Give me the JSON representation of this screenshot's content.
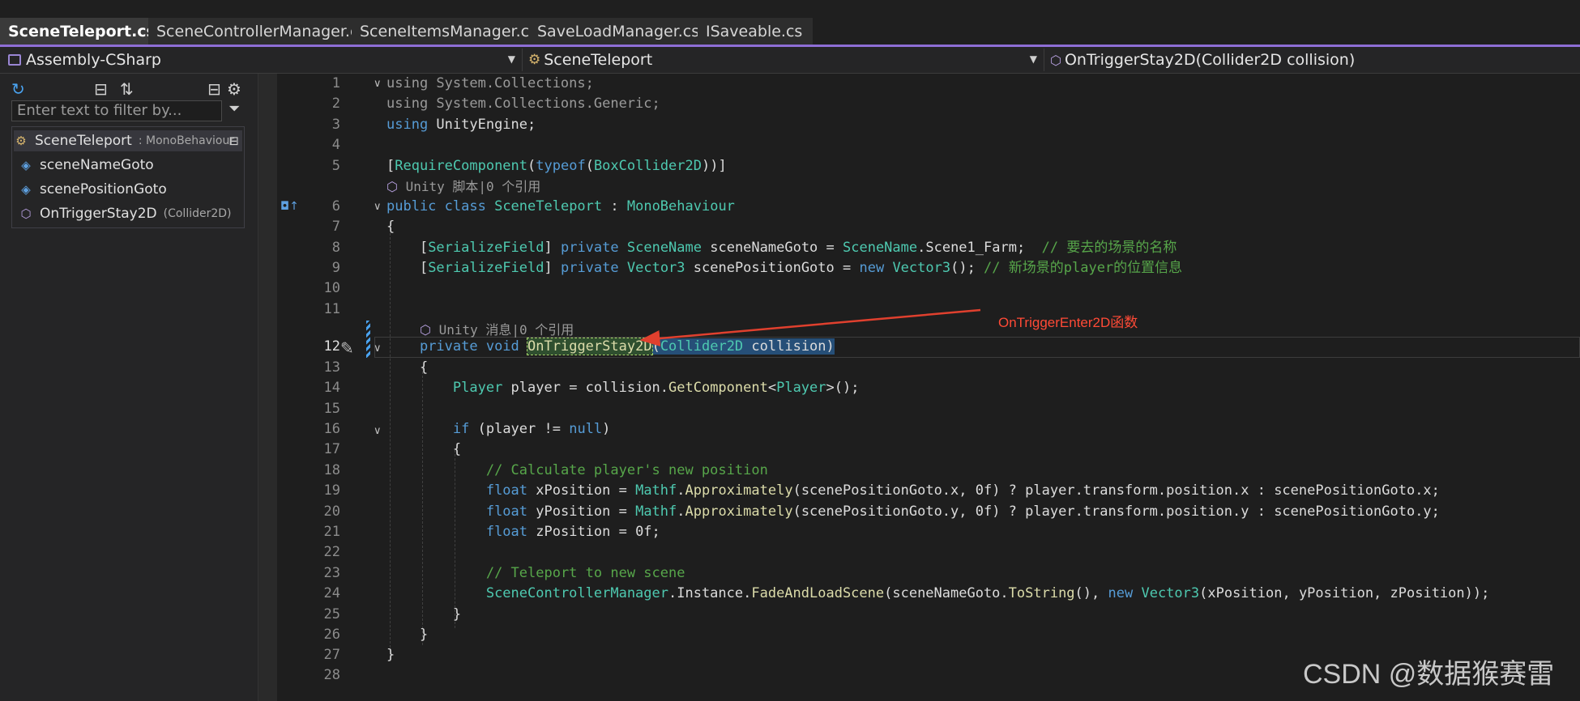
{
  "tabs": [
    {
      "label": "SceneTeleport.cs",
      "active": true
    },
    {
      "label": "SceneControllerManager.cs",
      "active": false
    },
    {
      "label": "SceneItemsManager.cs",
      "active": false
    },
    {
      "label": "SaveLoadManager.cs",
      "active": false
    },
    {
      "label": "ISaveable.cs",
      "active": false
    }
  ],
  "tab_pin_icon": "pin-icon",
  "tab_close_icon": "close-icon",
  "nav": {
    "project": "Assembly-CSharp",
    "type": "SceneTeleport",
    "member": "OnTriggerStay2D(Collider2D collision)"
  },
  "outline": {
    "filter_placeholder": "Enter text to filter by...",
    "class_name": "SceneTeleport",
    "class_base": ": MonoBehaviour",
    "collapse_glyph": "⊟",
    "members": [
      {
        "name": "sceneNameGoto",
        "detail": ""
      },
      {
        "name": "scenePositionGoto",
        "detail": ""
      },
      {
        "name": "OnTriggerStay2D",
        "detail": "(Collider2D)"
      }
    ]
  },
  "code": {
    "hint_class": "Unity 脚本|0 个引用",
    "hint_method": "Unity 消息|0 个引用",
    "line_numbers": [
      "1",
      "2",
      "3",
      "4",
      "5",
      "6",
      "7",
      "8",
      "9",
      "10",
      "11",
      "12",
      "13",
      "14",
      "15",
      "16",
      "17",
      "18",
      "19",
      "20",
      "21",
      "22",
      "23",
      "24",
      "25",
      "26",
      "27",
      "28"
    ]
  },
  "annotation": "OnTriggerEnter2D函数",
  "watermark": "CSDN @数据猴赛雷",
  "colors": {
    "accent": "#8e6ed6",
    "annotation": "#ff4a36",
    "keyword": "#569cd6",
    "type": "#4ec9b0",
    "method": "#dcdcaa",
    "comment": "#57a64a"
  }
}
